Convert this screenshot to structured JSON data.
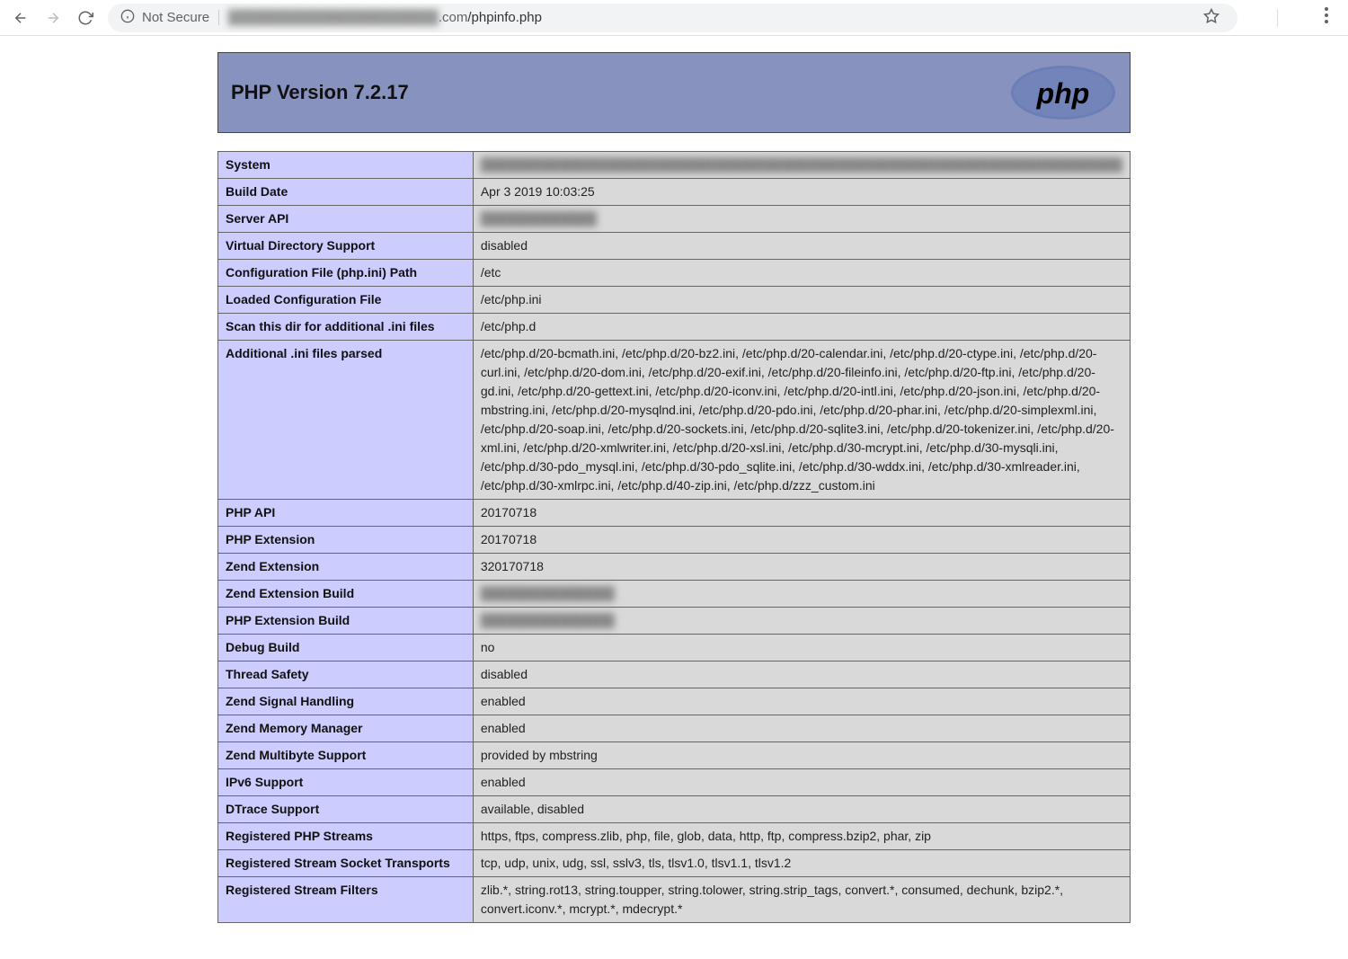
{
  "browser": {
    "not_secure_label": "Not Secure",
    "url_host_blurred": "██████████████████████",
    "url_domain_suffix": ".com",
    "url_path": "/phpinfo.php"
  },
  "header": {
    "title": "PHP Version 7.2.17"
  },
  "rows": [
    {
      "k": "System",
      "v": "████████████████████████████████████████████████████████████████████████",
      "blur": true
    },
    {
      "k": "Build Date",
      "v": "Apr 3 2019 10:03:25"
    },
    {
      "k": "Server API",
      "v": "█████████████",
      "blur": true
    },
    {
      "k": "Virtual Directory Support",
      "v": "disabled"
    },
    {
      "k": "Configuration File (php.ini) Path",
      "v": "/etc"
    },
    {
      "k": "Loaded Configuration File",
      "v": "/etc/php.ini"
    },
    {
      "k": "Scan this dir for additional .ini files",
      "v": "/etc/php.d"
    },
    {
      "k": "Additional .ini files parsed",
      "v": "/etc/php.d/20-bcmath.ini, /etc/php.d/20-bz2.ini, /etc/php.d/20-calendar.ini, /etc/php.d/20-ctype.ini, /etc/php.d/20-curl.ini, /etc/php.d/20-dom.ini, /etc/php.d/20-exif.ini, /etc/php.d/20-fileinfo.ini, /etc/php.d/20-ftp.ini, /etc/php.d/20-gd.ini, /etc/php.d/20-gettext.ini, /etc/php.d/20-iconv.ini, /etc/php.d/20-intl.ini, /etc/php.d/20-json.ini, /etc/php.d/20-mbstring.ini, /etc/php.d/20-mysqlnd.ini, /etc/php.d/20-pdo.ini, /etc/php.d/20-phar.ini, /etc/php.d/20-simplexml.ini, /etc/php.d/20-soap.ini, /etc/php.d/20-sockets.ini, /etc/php.d/20-sqlite3.ini, /etc/php.d/20-tokenizer.ini, /etc/php.d/20-xml.ini, /etc/php.d/20-xmlwriter.ini, /etc/php.d/20-xsl.ini, /etc/php.d/30-mcrypt.ini, /etc/php.d/30-mysqli.ini, /etc/php.d/30-pdo_mysql.ini, /etc/php.d/30-pdo_sqlite.ini, /etc/php.d/30-wddx.ini, /etc/php.d/30-xmlreader.ini, /etc/php.d/30-xmlrpc.ini, /etc/php.d/40-zip.ini, /etc/php.d/zzz_custom.ini"
    },
    {
      "k": "PHP API",
      "v": "20170718"
    },
    {
      "k": "PHP Extension",
      "v": "20170718"
    },
    {
      "k": "Zend Extension",
      "v": "320170718"
    },
    {
      "k": "Zend Extension Build",
      "v": "███████████████",
      "blur": true
    },
    {
      "k": "PHP Extension Build",
      "v": "███████████████",
      "blur": true
    },
    {
      "k": "Debug Build",
      "v": "no"
    },
    {
      "k": "Thread Safety",
      "v": "disabled"
    },
    {
      "k": "Zend Signal Handling",
      "v": "enabled"
    },
    {
      "k": "Zend Memory Manager",
      "v": "enabled"
    },
    {
      "k": "Zend Multibyte Support",
      "v": "provided by mbstring"
    },
    {
      "k": "IPv6 Support",
      "v": "enabled"
    },
    {
      "k": "DTrace Support",
      "v": "available, disabled"
    },
    {
      "k": "Registered PHP Streams",
      "v": "https, ftps, compress.zlib, php, file, glob, data, http, ftp, compress.bzip2, phar, zip"
    },
    {
      "k": "Registered Stream Socket Transports",
      "v": "tcp, udp, unix, udg, ssl, sslv3, tls, tlsv1.0, tlsv1.1, tlsv1.2"
    },
    {
      "k": "Registered Stream Filters",
      "v": "zlib.*, string.rot13, string.toupper, string.tolower, string.strip_tags, convert.*, consumed, dechunk, bzip2.*, convert.iconv.*, mcrypt.*, mdecrypt.*"
    }
  ]
}
